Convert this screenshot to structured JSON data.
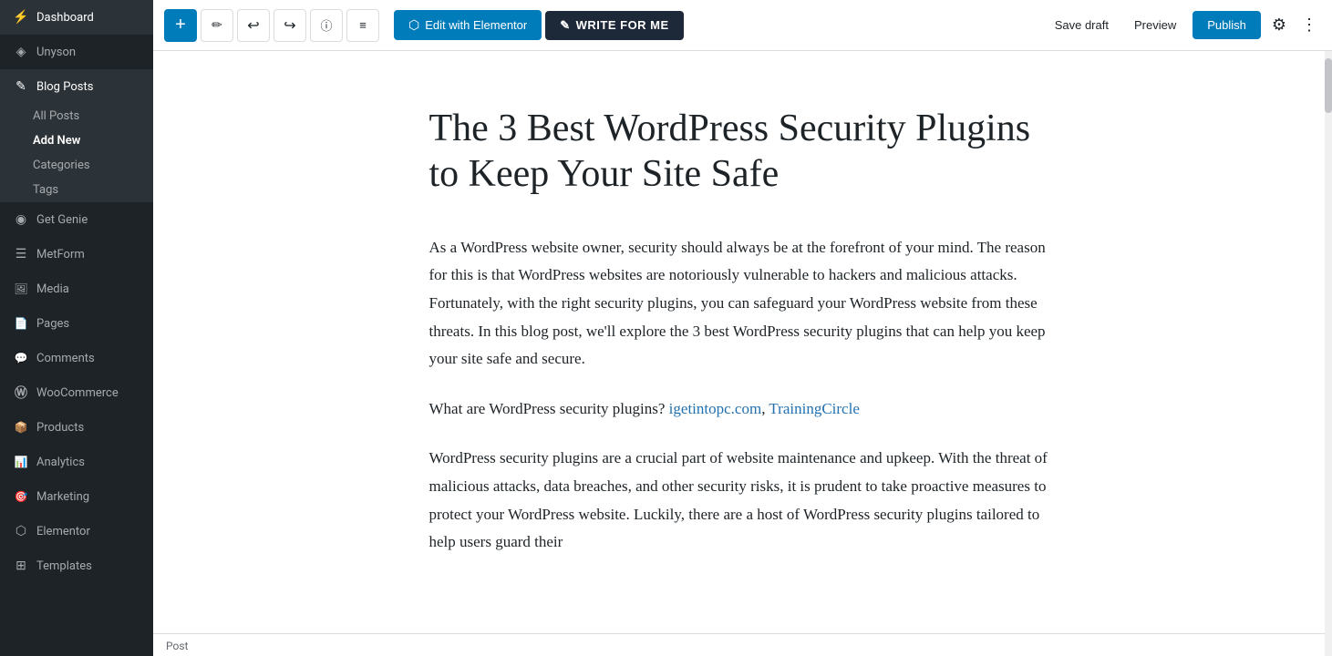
{
  "sidebar": {
    "items": [
      {
        "id": "dashboard",
        "label": "Dashboard",
        "icon": "⚡"
      },
      {
        "id": "unyson",
        "label": "Unyson",
        "icon": "◈"
      },
      {
        "id": "blog-posts",
        "label": "Blog Posts",
        "icon": "✎",
        "active": true,
        "expanded": true
      },
      {
        "id": "get-genie",
        "label": "Get Genie",
        "icon": "◉"
      },
      {
        "id": "metform",
        "label": "MetForm",
        "icon": "☰"
      },
      {
        "id": "media",
        "label": "Media",
        "icon": "🖼"
      },
      {
        "id": "pages",
        "label": "Pages",
        "icon": "📄"
      },
      {
        "id": "comments",
        "label": "Comments",
        "icon": "💬"
      },
      {
        "id": "woocommerce",
        "label": "WooCommerce",
        "icon": "Ⓦ"
      },
      {
        "id": "products",
        "label": "Products",
        "icon": "📦"
      },
      {
        "id": "analytics",
        "label": "Analytics",
        "icon": "📊"
      },
      {
        "id": "marketing",
        "label": "Marketing",
        "icon": "🎯"
      },
      {
        "id": "elementor",
        "label": "Elementor",
        "icon": "⬡"
      },
      {
        "id": "templates",
        "label": "Templates",
        "icon": "⊞"
      }
    ],
    "blog_submenu": [
      {
        "id": "all-posts",
        "label": "All Posts"
      },
      {
        "id": "add-new",
        "label": "Add New",
        "active": true
      },
      {
        "id": "categories",
        "label": "Categories"
      },
      {
        "id": "tags",
        "label": "Tags"
      }
    ]
  },
  "toolbar": {
    "add_label": "+",
    "edit_elementor_label": "Edit with Elementor",
    "write_for_me_label": "WRITE FOR ME",
    "save_draft_label": "Save draft",
    "preview_label": "Preview",
    "publish_label": "Publish"
  },
  "editor": {
    "title": "The 3 Best WordPress Security Plugins to Keep Your Site Safe",
    "paragraphs": [
      "As a WordPress website owner, security should always be at the forefront of your mind. The reason for this is that WordPress websites are notoriously vulnerable to hackers and malicious attacks. Fortunately, with the right security plugins, you can safeguard your WordPress website from these threats. In this blog post, we'll explore the 3 best WordPress security plugins that can help you keep your site safe and secure.",
      "What are WordPress security plugins? igetintopc.com, TrainingCircle",
      "WordPress security plugins are a crucial part of website maintenance and upkeep. With the threat of malicious attacks, data breaches, and other security risks, it is prudent to take proactive measures to protect your WordPress website. Luckily, there are a host of WordPress security plugins tailored to help users guard their"
    ]
  },
  "bottom_bar": {
    "label": "Post"
  },
  "colors": {
    "sidebar_bg": "#1d2327",
    "sidebar_active": "#2271b1",
    "toolbar_bg": "#ffffff",
    "publish_btn": "#007cba",
    "write_btn": "#1d2939"
  }
}
